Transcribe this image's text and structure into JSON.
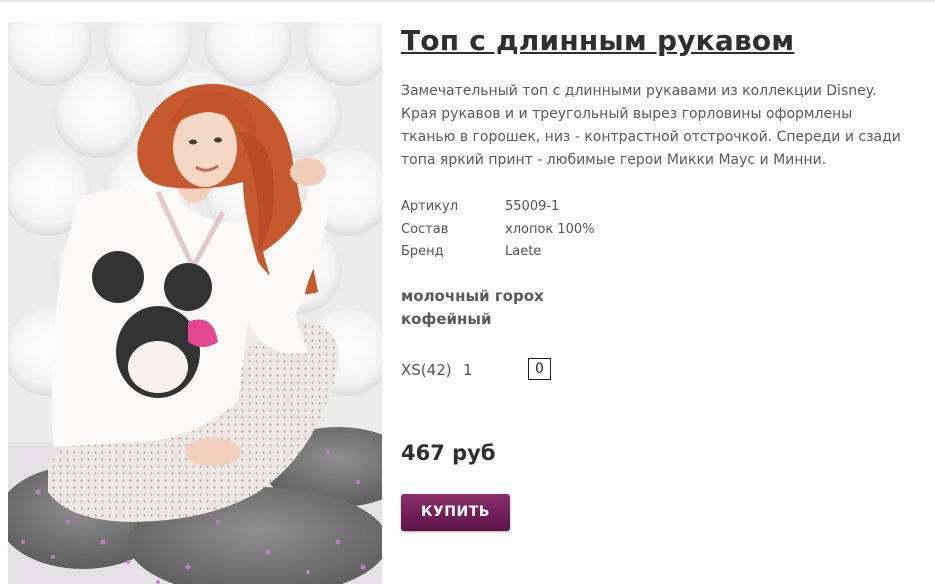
{
  "product": {
    "title": "Топ с длинным рукавом",
    "description": "Замечательный топ с длинными рукавами из коллекции Disney. Края рукавов и и треугольный вырез горловины оформлены тканью в горошек, низ - контрастной отстрочкой. Спереди и сзади топа яркий принт - любимые герои Микки Маус и Минни.",
    "specs": [
      {
        "label": "Артикул",
        "value": "55009-1"
      },
      {
        "label": "Состав",
        "value": "хлопок 100%"
      },
      {
        "label": "Бренд",
        "value": "Laete"
      }
    ],
    "colors": [
      "молочный горох",
      "кофейный"
    ],
    "sizes": [
      {
        "label": "XS(42)",
        "stock": "1",
        "quantity": "0"
      }
    ],
    "price": "467 руб",
    "buy_label": "КУПИТЬ"
  },
  "theme": {
    "button_color": "#6f1f58",
    "title_color": "#2f2f2f"
  }
}
